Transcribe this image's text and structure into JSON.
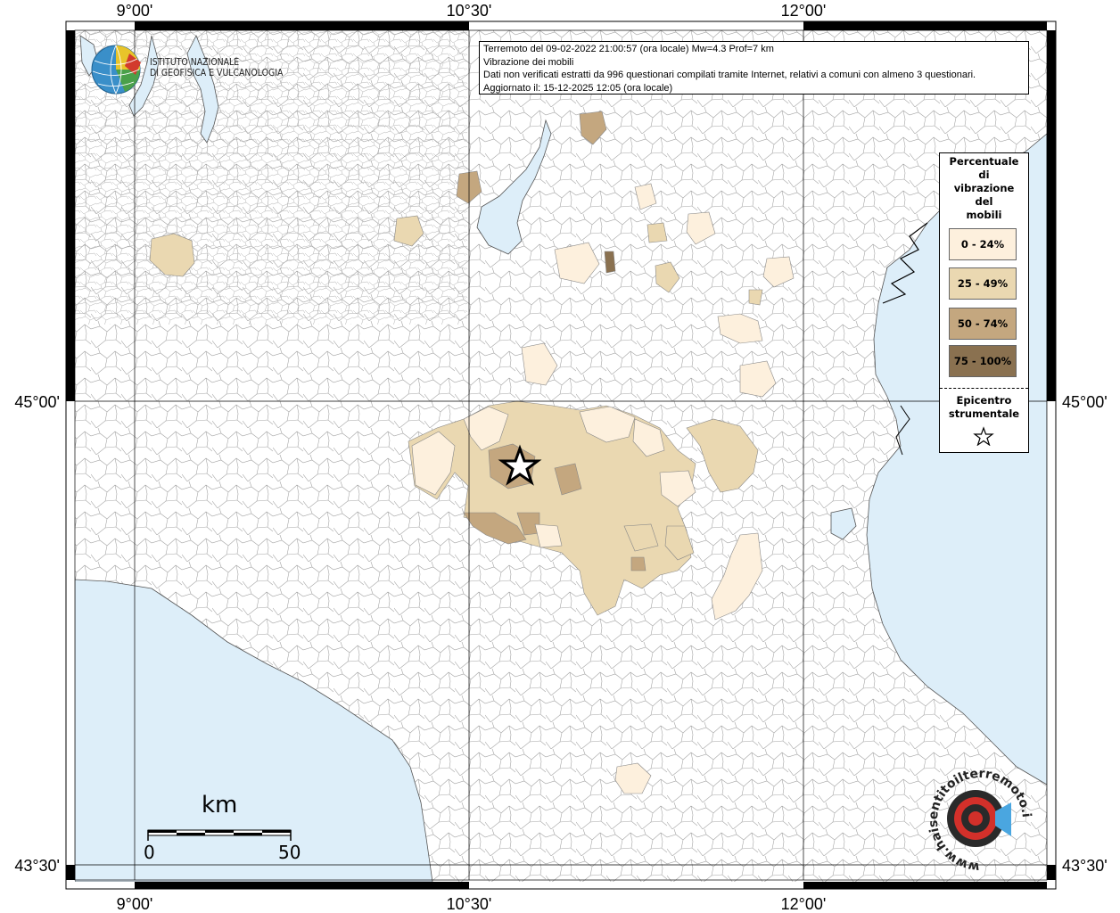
{
  "header": {
    "line1": "Terremoto del 09-02-2022 21:00:57 (ora locale) Mw=4.3 Prof=7 km",
    "line2": "Vibrazione dei mobili",
    "line3": "Dati non verificati estratti da 996 questionari compilati tramite Internet, relativi a comuni con almeno 3 questionari.",
    "line4": "Aggiornato il: 15-12-2025 12:05 (ora locale)"
  },
  "institute": {
    "name_line1": "ISTITUTO NAZIONALE",
    "name_line2": "DI GEOFISICA E VULCANOLOGIA"
  },
  "axes": {
    "lon_labels": [
      "9°00'",
      "10°30'",
      "12°00'"
    ],
    "lat_labels": [
      "45°00'",
      "43°30'"
    ]
  },
  "legend": {
    "title_lines": [
      "Percentuale",
      "di",
      "vibrazione",
      "del",
      "mobili"
    ],
    "classes": [
      {
        "label": "0 - 24%",
        "color": "#fdf0dd"
      },
      {
        "label": "25 - 49%",
        "color": "#ead8b1"
      },
      {
        "label": "50 - 74%",
        "color": "#c4a77f"
      },
      {
        "label": "75 - 100%",
        "color": "#8a7150"
      }
    ],
    "epicenter_lines": [
      "Epicentro",
      "strumentale"
    ]
  },
  "scale_bar": {
    "unit": "km",
    "start": "0",
    "end": "50"
  },
  "colors": {
    "sea": "#ddeef9",
    "land": "#ffffff",
    "borders": "#9a9a9a"
  },
  "brand": {
    "text": "www.haisentitoilterremoto.it"
  }
}
